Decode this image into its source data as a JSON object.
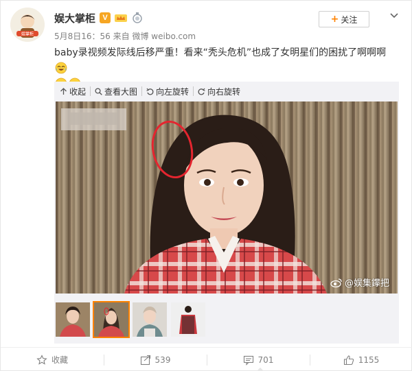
{
  "user": {
    "name": "娱大掌柜",
    "badge": "V",
    "avatar_caption": "娱掌柜"
  },
  "meta": {
    "time": "5月8日16：56",
    "from_label": "来自",
    "source": "微博 weibo.com"
  },
  "follow": {
    "plus": "+",
    "label": "关注"
  },
  "post": {
    "text": "baby录视频发际线后移严重！看来“秃头危机”也成了女明星们的困扰了啊啊啊"
  },
  "toolbar": {
    "collapse": "收起",
    "view_large": "查看大图",
    "rotate_left": "向左旋转",
    "rotate_right": "向右旋转"
  },
  "photo": {
    "watermark_text": "@娱集鑻把"
  },
  "thumbnails": {
    "count": 4,
    "active_index": 1
  },
  "actions": {
    "favorite": "收藏",
    "repost": "539",
    "comment": "701",
    "like": "1155"
  },
  "colors": {
    "accent": "#ff8200",
    "badge": "#f6a623",
    "circle": "#e5252f"
  }
}
